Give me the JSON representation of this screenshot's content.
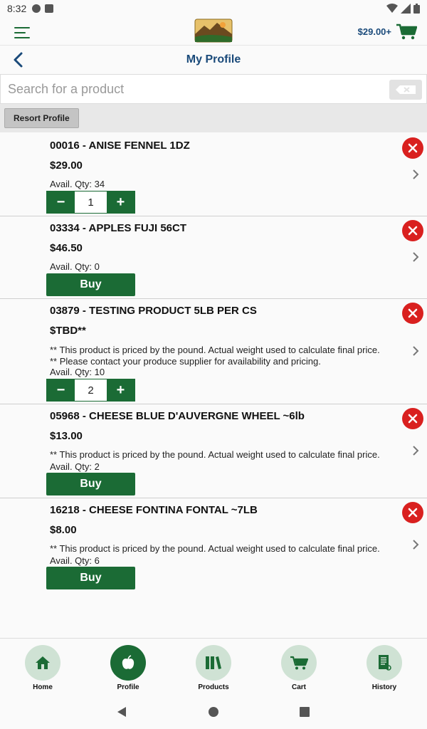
{
  "status_bar": {
    "time": "8:32"
  },
  "header": {
    "logo_alt": "store logo",
    "cart_total": "$29.00+"
  },
  "title_bar": {
    "title": "My Profile"
  },
  "search": {
    "placeholder": "Search for a product",
    "value": ""
  },
  "toolbar": {
    "resort_label": "Resort Profile"
  },
  "items": [
    {
      "name": "00016 - ANISE FENNEL 1DZ",
      "price": "$29.00",
      "notes": [],
      "avail": "Avail. Qty: 34",
      "action": "stepper",
      "qty": "1"
    },
    {
      "name": "03334 - APPLES FUJI 56CT",
      "price": "$46.50",
      "notes": [],
      "avail": "Avail. Qty: 0",
      "action": "buy",
      "buy_label": "Buy"
    },
    {
      "name": "03879 - TESTING PRODUCT 5LB PER CS",
      "price": "$TBD**",
      "notes": [
        "** This product is priced by the pound.  Actual weight used to calculate final price.",
        "** Please contact your produce supplier for availability and pricing."
      ],
      "avail": "Avail. Qty: 10",
      "action": "stepper",
      "qty": "2"
    },
    {
      "name": "05968 - CHEESE BLUE D'AUVERGNE WHEEL ~6lb",
      "price": "$13.00",
      "notes": [
        "** This product is priced by the pound.  Actual weight used to calculate final price."
      ],
      "avail": "Avail. Qty: 2",
      "action": "buy",
      "buy_label": "Buy"
    },
    {
      "name": "16218 - CHEESE FONTINA FONTAL ~7LB",
      "price": "$8.00",
      "notes": [
        "** This product is priced by the pound.  Actual weight used to calculate final price."
      ],
      "avail": "Avail. Qty: 6",
      "action": "buy",
      "buy_label": "Buy"
    }
  ],
  "bottom_nav": [
    {
      "label": "Home",
      "icon": "home-icon",
      "active": false
    },
    {
      "label": "Profile",
      "icon": "apple-icon",
      "active": true
    },
    {
      "label": "Products",
      "icon": "books-icon",
      "active": false
    },
    {
      "label": "Cart",
      "icon": "cart-icon",
      "active": false
    },
    {
      "label": "History",
      "icon": "document-icon",
      "active": false
    }
  ],
  "colors": {
    "brand_green": "#1b6b35",
    "title_blue": "#1a4a7a",
    "remove_red": "#d9201f",
    "nav_circle": "#cfe2d4"
  }
}
